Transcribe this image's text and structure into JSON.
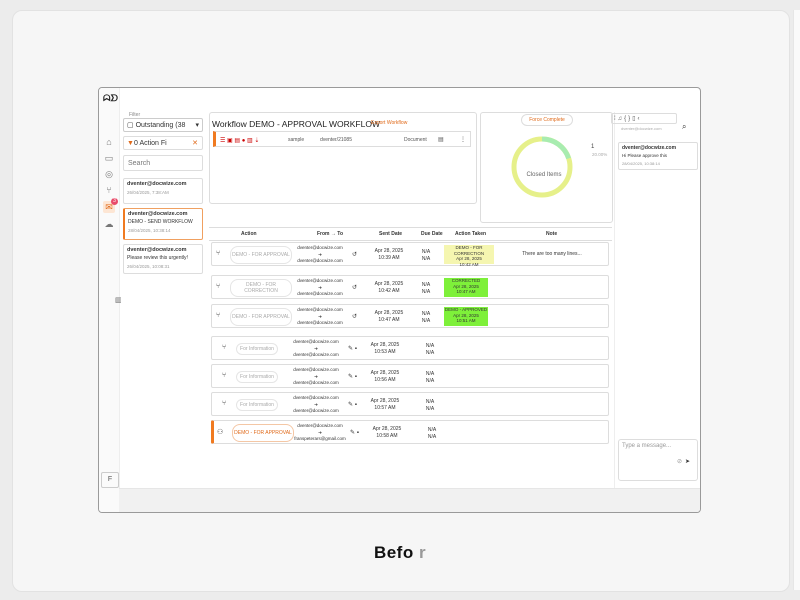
{
  "caption": {
    "main": "Befo",
    "faint": " r"
  },
  "nav": {
    "items": [
      "home-icon",
      "document-icon",
      "compass-icon",
      "workflow-icon",
      "inbox-icon",
      "cloud-icon"
    ],
    "badge": "3",
    "footer": "F"
  },
  "left_panel": {
    "filter_label": "Filter",
    "filter_value": "Outstanding (38",
    "action_filter": "0 Action Fi",
    "search_placeholder": "Search",
    "messages": [
      {
        "from": "dventer@docwize.com",
        "body": "",
        "time": "26/04/2025, 7:38:AM"
      },
      {
        "from": "dventer@docwize.com",
        "body": "DEMO - SEND WORKFLOW",
        "time": "28/04/2025, 10:38:14"
      },
      {
        "from": "dventer@docwize.com",
        "body": "Please review this urgently!",
        "time": "26/04/2025, 10:08:31"
      }
    ]
  },
  "workflow": {
    "title": "Workflow DEMO - APPROVAL WORKFLOW",
    "export": "Export Workflow",
    "doc_name": "sample",
    "doc_owner": "dventer/21085",
    "doc_type": "Document"
  },
  "chart": {
    "force_label": "Force Complete",
    "center_label": "Closed Items",
    "count": "1",
    "percent": "20.00%"
  },
  "chat": {
    "search_placeholder": "dventer@docwize.com",
    "card_from": "dventer@docwize.com",
    "card_body": "Hi Please approve this",
    "card_time": "28/04/2025, 10:38:14",
    "input_placeholder": "Type a message..."
  },
  "table": {
    "headers": [
      "Action",
      "From → To",
      "Sent Date",
      "Due Date",
      "Action Taken",
      "Note"
    ],
    "rows": [
      {
        "action": "DEMO - FOR APPROVAL",
        "from": "dventer@docwize.com",
        "arrow": "➜",
        "to": "dventer@docwize.com",
        "sent1": "Apr 28, 2025",
        "sent2": "10:39 AM",
        "due": "N/A",
        "due2": "N/A",
        "taken1": "DEMO - FOR CORRECTION",
        "taken2": "Apr 28, 2025",
        "taken3": "10:42 AM",
        "note": "There are too many lines..."
      },
      {
        "action": "DEMO - FOR CORRECTION",
        "from": "dventer@docwize.com",
        "arrow": "➜",
        "to": "dventer@docwize.com",
        "sent1": "Apr 28, 2025",
        "sent2": "10:42 AM",
        "due": "N/A",
        "due2": "N/A",
        "taken1": "CORRECTED",
        "taken2": "Apr 28, 2025",
        "taken3": "10:47 AM",
        "note": ""
      },
      {
        "action": "DEMO - FOR APPROVAL",
        "from": "dventer@docwize.com",
        "arrow": "➜",
        "to": "dventer@docwize.com",
        "sent1": "Apr 28, 2025",
        "sent2": "10:47 AM",
        "due": "N/A",
        "due2": "N/A",
        "taken1": "DEMO - APPROVED",
        "taken2": "Apr 28, 2025",
        "taken3": "10:51 AM",
        "note": ""
      },
      {
        "action": "For Information",
        "from": "dventer@docwize.com",
        "arrow": "➜",
        "to": "dventer@docwize.com",
        "sent1": "Apr 28, 2025",
        "sent2": "10:53 AM",
        "due": "N/A",
        "due2": "N/A"
      },
      {
        "action": "For Information",
        "from": "dventer@docwize.com",
        "arrow": "➜",
        "to": "dventer@docwize.com",
        "sent1": "Apr 28, 2025",
        "sent2": "10:56 AM",
        "due": "N/A",
        "due2": "N/A"
      },
      {
        "action": "For Information",
        "from": "dventer@docwize.com",
        "arrow": "➜",
        "to": "dventer@docwize.com",
        "sent1": "Apr 28, 2025",
        "sent2": "10:57 AM",
        "due": "N/A",
        "due2": "N/A"
      },
      {
        "action": "DEMO - FOR APPROVAL",
        "from": "dventer@docwize.com",
        "arrow": "➜",
        "to": "franspeterars@gmail.com",
        "sent1": "Apr 28, 2025",
        "sent2": "10:58 AM",
        "due": "N/A",
        "due2": "N/A"
      }
    ]
  }
}
